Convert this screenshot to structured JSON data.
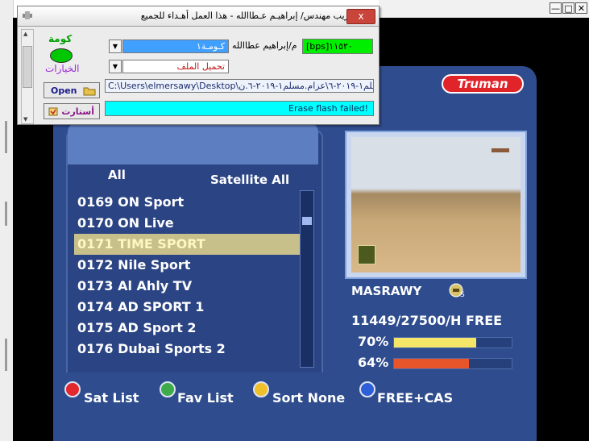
{
  "dialog": {
    "title": "تعريب مهندس/ إبراهيـم عـطاالله - هذا العمل أهـداء للجميع",
    "close_label": "x",
    "status_label": "كومة",
    "options_label": "الخيارات",
    "baud_value": "[bps]١١٥٢٠",
    "author_label": "م/إبراهيم عطاالله",
    "port_value": "كـومـة١",
    "load_label": "تحميل الملف",
    "load_value": "",
    "path_value": "C:\\Users\\elmersawy\\Desktop\\عزام.مسلم١-٢٠١٩-٦\\عزام.مسلم١-٢٠١٩-٦.ن",
    "open_label": "Open",
    "restart_label": "أستارت",
    "log_value": "Erase flash failed!",
    "colors": {
      "status_oval": "#00c800",
      "baud_bg": "#00ee00",
      "port_bg": "#3fa0ff",
      "log_bg": "#00ffff",
      "options_text": "#9a2bd6"
    }
  },
  "window_controls": {
    "minimize": "—",
    "maximize": "□",
    "close": "✕"
  },
  "tv": {
    "logo": "Truman",
    "tab_all": "All",
    "tab_satellite": "Satellite All",
    "channels": [
      {
        "label": "0169  ON  Sport"
      },
      {
        "label": "0170  ON  Live"
      },
      {
        "label": "0171  TIME SPORT"
      },
      {
        "label": "0172  Nile Sport"
      },
      {
        "label": "0173  Al Ahly TV"
      },
      {
        "label": "0174  AD SPORT 1"
      },
      {
        "label": "0175  AD Sport 2"
      },
      {
        "label": "0176  Dubai Sports 2"
      }
    ],
    "selected_index": 2,
    "info_name": "MASRAWY",
    "freq": "11449/27500/H  FREE",
    "signal_strength_pct": "70%",
    "signal_quality_pct": "64%",
    "signal_strength": 0.7,
    "signal_quality": 0.64,
    "colors": {
      "strength_bar": "#f5e66a",
      "quality_bar": "#e8552a"
    },
    "buttons": [
      {
        "label": "Sat List",
        "color": "#e2272d"
      },
      {
        "label": "Fav List",
        "color": "#3dab4a"
      },
      {
        "label": "Sort None",
        "color": "#f0c02a"
      },
      {
        "label": "FREE+CAS",
        "color": "#2f5fd8"
      }
    ]
  }
}
